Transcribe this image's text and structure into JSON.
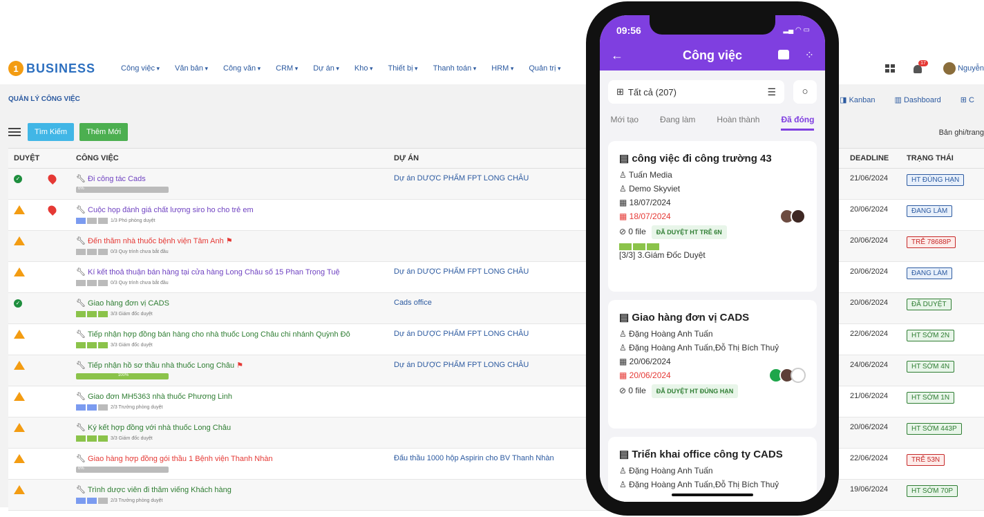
{
  "app": {
    "logo_num": "1",
    "logo_text": "BUSINESS"
  },
  "menu": [
    "Công việc",
    "Văn bản",
    "Công văn",
    "CRM",
    "Dự án",
    "Kho",
    "Thiết bị",
    "Thanh toán",
    "HRM",
    "Quản trị"
  ],
  "nav": {
    "notif_count": "17",
    "user": "Nguyễn"
  },
  "page": {
    "title": "QUẢN LÝ CÔNG VIỆC",
    "search_btn": "Tìm Kiếm",
    "add_btn": "Thêm Mới",
    "rows_per_page": "Bản ghi/trang"
  },
  "views": [
    "Kanban",
    "Dashboard",
    "⊞ C"
  ],
  "table": {
    "headers": [
      "DUYỆT",
      "CÔNG VIỆC",
      "DỰ ÁN",
      "DEADLINE",
      "TRẠNG THÁI"
    ],
    "rows": [
      {
        "approved": "ok",
        "pin": true,
        "task": "Đi công tác Cads",
        "task_color": "purple",
        "progress": "0%",
        "progress_type": "bar",
        "project": "Dự án DƯỢC PHẨM FPT LONG CHÂU",
        "deadline": "21/06/2024",
        "status": "HT ĐÚNG HẠN",
        "status_color": "b"
      },
      {
        "approved": "warn",
        "pin": true,
        "task": "Cuộc họp đánh giá chất lượng siro ho cho trẻ em",
        "task_color": "purple",
        "progress": "1/3 Phó phòng duyệt",
        "progress_type": "seg",
        "project": "",
        "deadline": "20/06/2024",
        "status": "ĐANG LÀM",
        "status_color": "b"
      },
      {
        "approved": "warn",
        "pin": false,
        "task": "Đến thăm nhà thuốc bệnh viện Tâm Anh",
        "task_color": "red",
        "flag": true,
        "progress": "0/3 Quy trình chưa bắt đầu",
        "progress_type": "seg",
        "project": "",
        "deadline": "20/06/2024",
        "status": "TRỄ 78688P",
        "status_color": "r"
      },
      {
        "approved": "warn",
        "pin": false,
        "task": "Kí kết thoả thuận bán hàng tại cửa hàng Long Châu số 15 Phan Trọng Tuệ",
        "task_color": "purple",
        "progress": "0/3 Quy trình chưa bắt đầu",
        "progress_type": "seg",
        "project": "Dự án DƯỢC PHẨM FPT LONG CHÂU",
        "deadline": "20/06/2024",
        "status": "ĐANG LÀM",
        "status_color": "b"
      },
      {
        "approved": "ok",
        "pin": false,
        "task": "Giao hàng đơn vị CADS",
        "task_color": "green",
        "progress": "3/3 Giám đốc duyệt",
        "progress_type": "seg",
        "project": "Cads office",
        "deadline": "20/06/2024",
        "status": "ĐÃ DUYỆT",
        "status_color": "g"
      },
      {
        "approved": "warn",
        "pin": false,
        "task": "Tiếp nhận hợp đồng bán hàng cho nhà thuốc Long Châu chi nhánh Quỳnh Đô",
        "task_color": "green",
        "progress": "3/3 Giám đốc duyệt",
        "progress_type": "seg",
        "project": "Dự án DƯỢC PHẨM FPT LONG CHÂU",
        "deadline": "22/06/2024",
        "status": "HT SỚM 2N",
        "status_color": "g"
      },
      {
        "approved": "warn",
        "pin": false,
        "task": "Tiếp nhận hồ sơ thầu nhà thuốc Long Châu",
        "task_color": "green",
        "flag": true,
        "progress": "100%",
        "progress_type": "bar",
        "project": "Dự án DƯỢC PHẨM FPT LONG CHÂU",
        "deadline": "24/06/2024",
        "status": "HT SỚM 4N",
        "status_color": "g"
      },
      {
        "approved": "warn",
        "pin": false,
        "task": "Giao đơn MH5363 nhà thuốc Phương Linh",
        "task_color": "green",
        "progress": "2/3 Trưởng phòng duyệt",
        "progress_type": "seg",
        "project": "",
        "deadline": "21/06/2024",
        "status": "HT SỚM 1N",
        "status_color": "g"
      },
      {
        "approved": "warn",
        "pin": false,
        "task": "Ký kết hợp đồng với nhà thuốc Long Châu",
        "task_color": "green",
        "progress": "3/3 Giám đốc duyệt",
        "progress_type": "seg",
        "project": "",
        "deadline": "20/06/2024",
        "status": "HT SỚM 443P",
        "status_color": "g"
      },
      {
        "approved": "warn",
        "pin": false,
        "task": "Giao hàng hợp đồng gói thầu 1 Bệnh viện Thanh Nhàn",
        "task_color": "red",
        "progress": "0%",
        "progress_type": "bar",
        "project": "Đấu thầu 1000 hộp Aspirin cho BV Thanh Nhàn",
        "deadline": "22/06/2024",
        "status": "TRỄ 53N",
        "status_color": "r"
      },
      {
        "approved": "warn",
        "pin": false,
        "task": "Trình dược viên đi thăm viếng Khách hàng",
        "task_color": "green",
        "progress": "2/3 Trưởng phòng duyệt",
        "progress_type": "seg",
        "project": "",
        "deadline": "19/06/2024",
        "status": "HT SỚM 70P",
        "status_color": "g"
      }
    ]
  },
  "phone": {
    "time": "09:56",
    "title": "Công việc",
    "filter": "Tất cả (207)",
    "tabs": [
      "Mới tạo",
      "Đang làm",
      "Hoàn thành",
      "Đã đóng"
    ],
    "cards": [
      {
        "title": "công việc đi công trường 43",
        "assignee": "Tuấn Media",
        "followers": "Demo Skyviet",
        "start": "18/07/2024",
        "end": "18/07/2024",
        "files": "0 file",
        "chip": "ĐÃ DUYỆT HT TRỄ 6N",
        "step": "[3/3] 3.Giám Đốc Duyệt"
      },
      {
        "title": "Giao hàng đơn vị CADS",
        "assignee": "Đặng Hoàng Anh Tuấn",
        "followers": "Đặng Hoàng Anh Tuấn,Đỗ Thị Bích Thuỷ",
        "start": "20/06/2024",
        "end": "20/06/2024",
        "files": "0 file",
        "chip": "ĐÃ DUYỆT HT ĐÚNG HẠN"
      },
      {
        "title": "Triển khai office công ty CADS",
        "assignee": "Đặng Hoàng Anh Tuấn",
        "followers": "Đặng Hoàng Anh Tuấn,Đỗ Thị Bích Thuỷ"
      }
    ]
  }
}
